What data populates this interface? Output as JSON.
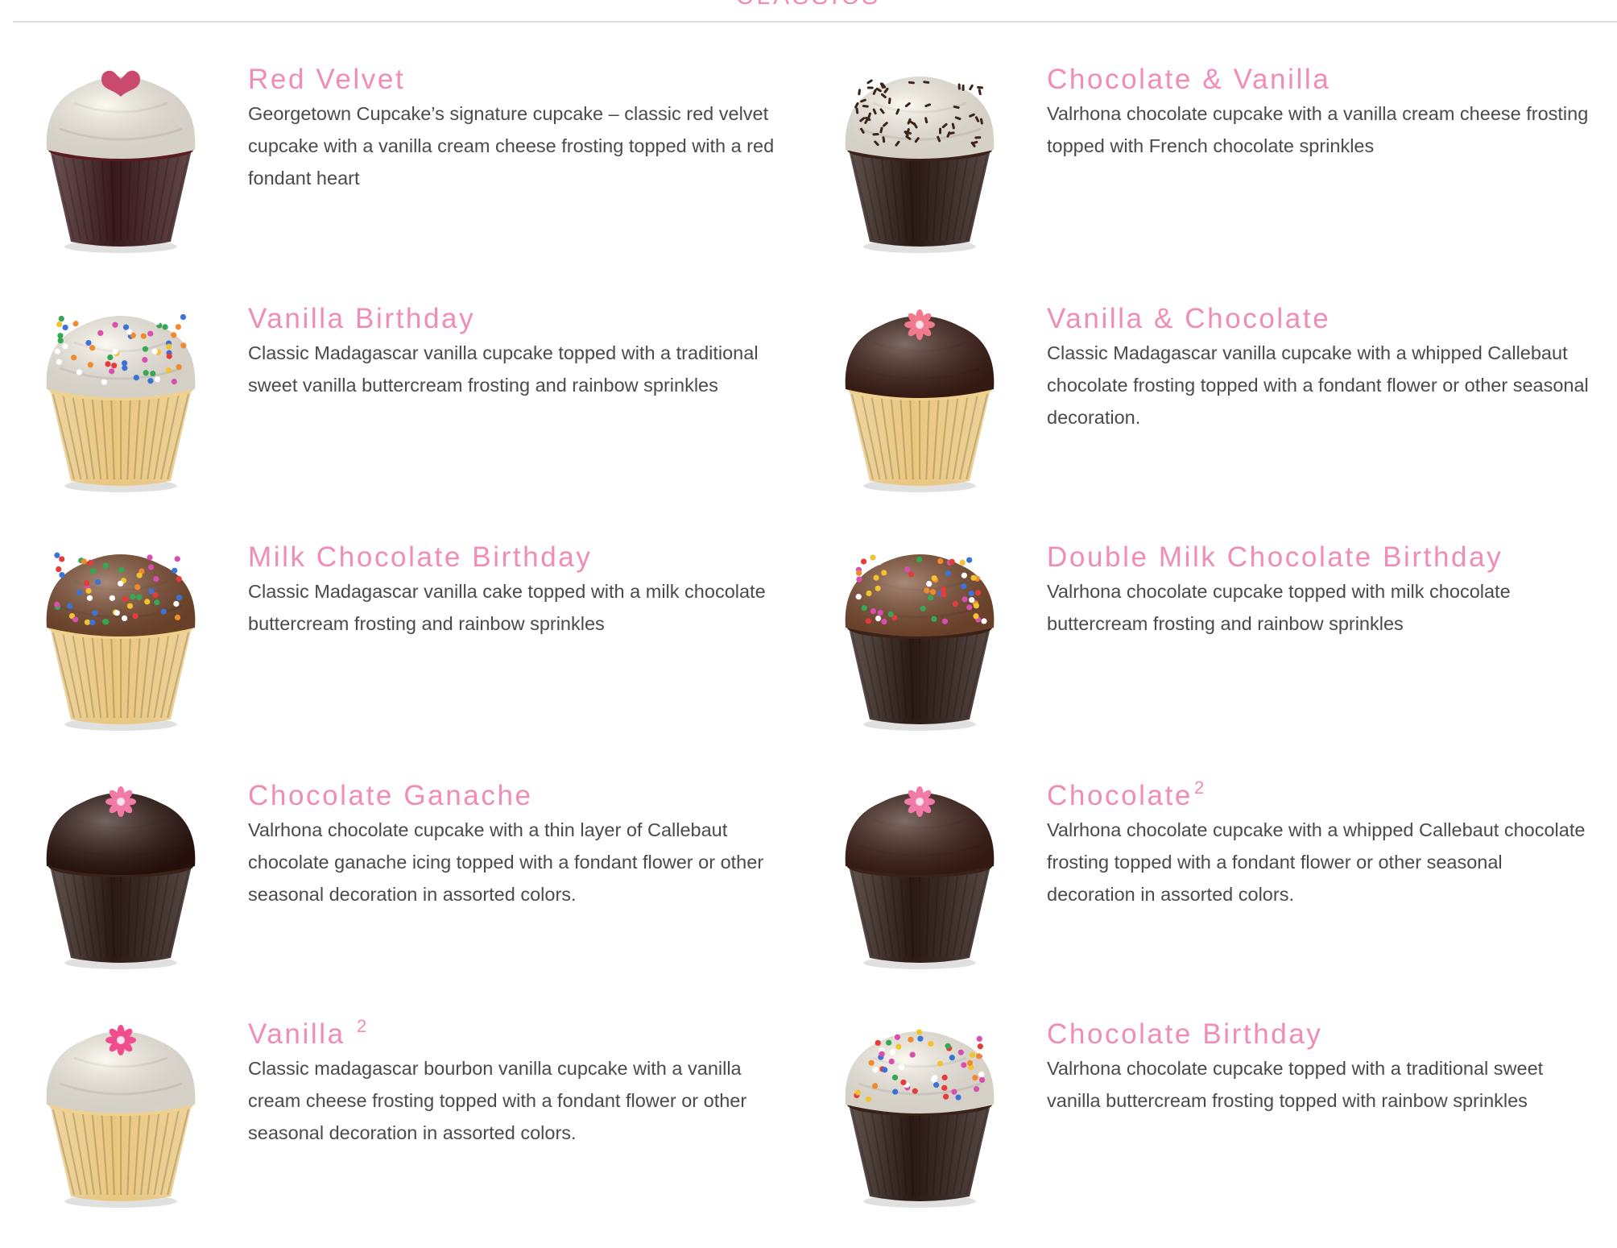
{
  "section": {
    "title": "CLASSICS"
  },
  "items": [
    {
      "name": "Red Velvet",
      "sup": "",
      "description": "Georgetown Cupcake’s signature cupcake – classic red velvet cupcake with a vanilla cream cheese frosting topped with a red fondant heart",
      "colors": {
        "liner": "#3a1a1c",
        "cake": "#5a1c20",
        "frosting": "#fbf6ea",
        "topping": "#c94a6e"
      },
      "topping": "heart-icon"
    },
    {
      "name": "Chocolate & Vanilla",
      "sup": "",
      "description": "Valrhona chocolate cupcake with a vanilla cream cheese frosting topped with French chocolate sprinkles",
      "colors": {
        "liner": "#2b1a14",
        "cake": "#3b2219",
        "frosting": "#fbf6ea",
        "topping": "#3a2418"
      },
      "topping": "chocolate-sprinkles-icon"
    },
    {
      "name": "Vanilla Birthday",
      "sup": "",
      "description": "Classic Madagascar vanilla cupcake topped with a traditional sweet vanilla buttercream frosting and rainbow sprinkles",
      "colors": {
        "liner": "#e9c77f",
        "cake": "#efd08c",
        "frosting": "#fbf6ea",
        "topping": "#e53b3b"
      },
      "topping": "rainbow-sprinkles-icon"
    },
    {
      "name": "Vanilla & Chocolate",
      "sup": "",
      "description": "Classic Madagascar vanilla cupcake with a whipped Callebaut chocolate frosting topped with a fondant flower or other seasonal decoration.",
      "colors": {
        "liner": "#e9c77f",
        "cake": "#efd08c",
        "frosting": "#3b1d14",
        "topping": "#f27a8c"
      },
      "topping": "flower-icon"
    },
    {
      "name": "Milk Chocolate Birthday",
      "sup": "",
      "description": "Classic Madagascar vanilla cake topped with a milk chocolate buttercream frosting and rainbow sprinkles",
      "colors": {
        "liner": "#e9c77f",
        "cake": "#efd08c",
        "frosting": "#7a4a2e",
        "topping": "#e53b3b"
      },
      "topping": "rainbow-sprinkles-icon"
    },
    {
      "name": "Double Milk Chocolate Birthday",
      "sup": "",
      "description": "Valrhona chocolate cupcake topped with milk chocolate buttercream frosting and rainbow sprinkles",
      "colors": {
        "liner": "#2b1a14",
        "cake": "#3b2219",
        "frosting": "#7a4a2e",
        "topping": "#e53b3b"
      },
      "topping": "rainbow-sprinkles-icon"
    },
    {
      "name": "Chocolate Ganache",
      "sup": "",
      "description": "Valrhona chocolate cupcake with a thin layer of Callebaut chocolate ganache icing topped with a fondant flower or other seasonal decoration in assorted colors.",
      "colors": {
        "liner": "#2b1a14",
        "cake": "#3b2219",
        "frosting": "#2a120c",
        "topping": "#f27aa6"
      },
      "topping": "flower-icon"
    },
    {
      "name": "Chocolate",
      "sup": "2",
      "description": "Valrhona chocolate cupcake with a whipped Callebaut chocolate frosting topped with a fondant flower or other seasonal decoration in assorted colors.",
      "colors": {
        "liner": "#2b1a14",
        "cake": "#3b2219",
        "frosting": "#3b1d14",
        "topping": "#f27aa6"
      },
      "topping": "flower-icon"
    },
    {
      "name": "Vanilla ",
      "sup": "2",
      "description": "Classic madagascar bourbon vanilla cupcake with a vanilla cream cheese frosting topped with a fondant flower or other seasonal decoration in assorted colors.",
      "colors": {
        "liner": "#e9c77f",
        "cake": "#efd08c",
        "frosting": "#fbf6ea",
        "topping": "#f04d8e"
      },
      "topping": "flower-icon"
    },
    {
      "name": "Chocolate Birthday",
      "sup": "",
      "description": "Valrhona chocolate cupcake topped with a traditional sweet vanilla buttercream frosting topped with rainbow sprinkles",
      "colors": {
        "liner": "#2b1a14",
        "cake": "#3b2219",
        "frosting": "#fbf6ea",
        "topping": "#e53b3b"
      },
      "topping": "rainbow-sprinkles-icon"
    }
  ]
}
